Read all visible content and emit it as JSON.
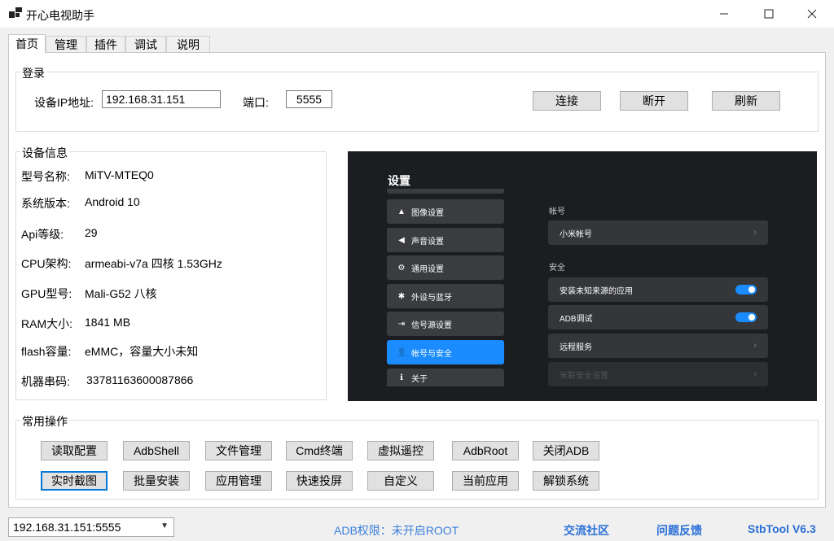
{
  "window": {
    "title": "开心电视助手",
    "minimize": "—",
    "maximize": "☐",
    "close": "✕"
  },
  "tabs": [
    {
      "label": "首页"
    },
    {
      "label": "管理"
    },
    {
      "label": "插件"
    },
    {
      "label": "调试"
    },
    {
      "label": "说明"
    }
  ],
  "login": {
    "group_title": "登录",
    "ip_label": "设备IP地址:",
    "ip_value": "192.168.31.151",
    "port_label": "端口:",
    "port_value": "5555",
    "connect": "连接",
    "disconnect": "断开",
    "refresh": "刷新"
  },
  "device_info": {
    "group_title": "设备信息",
    "rows": [
      {
        "label": "型号名称:",
        "value": "MiTV-MTEQ0"
      },
      {
        "label": "系统版本:",
        "value": "Android 10"
      },
      {
        "label": "Api等级:",
        "value": "29"
      },
      {
        "label": "CPU架构:",
        "value": "armeabi-v7a 四核 1.53GHz"
      },
      {
        "label": "GPU型号:",
        "value": "Mali-G52 八核"
      },
      {
        "label": "RAM大小:",
        "value": "1841 MB"
      },
      {
        "label": "flash容量:",
        "value": "eMMC，容量大小未知"
      },
      {
        "label": "机器串码:",
        "value": "33781163600087866"
      }
    ]
  },
  "tv_screen": {
    "title": "设置",
    "menu": [
      {
        "label": "图像设置",
        "icon": "▲"
      },
      {
        "label": "声音设置",
        "icon": "◀"
      },
      {
        "label": "通用设置",
        "icon": "⚙"
      },
      {
        "label": "外设与蓝牙",
        "icon": "✱"
      },
      {
        "label": "信号源设置",
        "icon": "⇥"
      },
      {
        "label": "帐号与安全",
        "icon": "👤"
      },
      {
        "label": "关于",
        "icon": "ℹ"
      }
    ],
    "section_account": "帐号",
    "mi_account": "小米帐号",
    "section_security": "安全",
    "unknown_sources": "安装未知来源的应用",
    "adb_debug": "ADB调试",
    "remote_service": "远程服务",
    "mi_security": "米联安全设置"
  },
  "common_ops": {
    "group_title": "常用操作",
    "row1": [
      "读取配置",
      "AdbShell",
      "文件管理",
      "Cmd终端",
      "虚拟遥控",
      "AdbRoot",
      "关闭ADB"
    ],
    "row2": [
      "实时截图",
      "批量安装",
      "应用管理",
      "快速投屏",
      "自定义",
      "当前应用",
      "解锁系统"
    ]
  },
  "status": {
    "device": "192.168.31.151:5555",
    "adb_permission": "ADB权限：未开启ROOT",
    "community": "交流社区",
    "feedback": "问题反馈",
    "version": "StbTool V6.3"
  }
}
